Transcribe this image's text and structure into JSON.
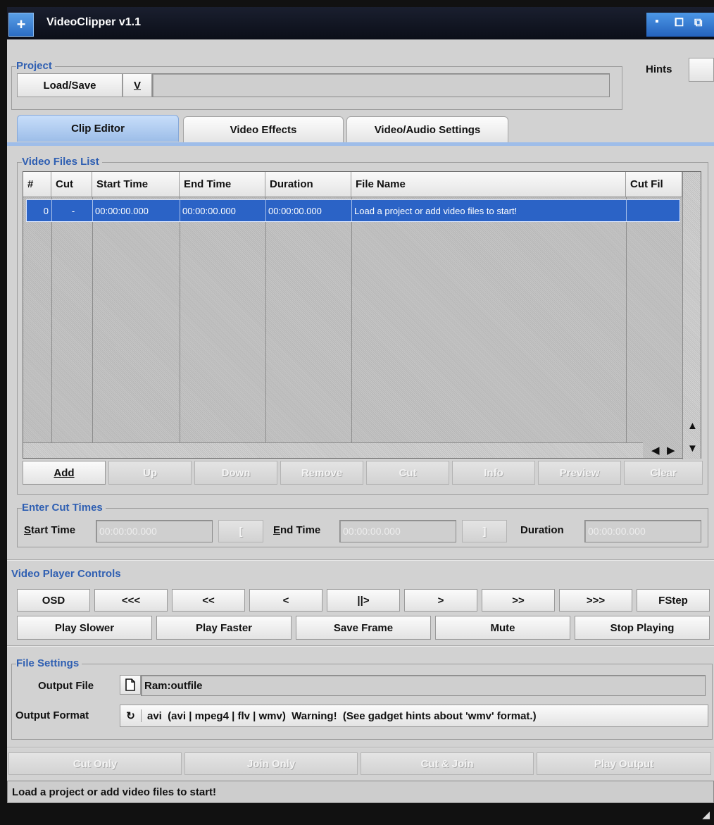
{
  "window": {
    "title": "VideoClipper v1.1"
  },
  "project": {
    "legend": "Project",
    "load_save_label": "Load/Save",
    "dropdown_label": "V",
    "project_field_value": "",
    "hints_label": "Hints"
  },
  "tabs": [
    {
      "label": "Clip Editor",
      "active": true
    },
    {
      "label": "Video Effects",
      "active": false
    },
    {
      "label": "Video/Audio Settings",
      "active": false
    }
  ],
  "video_files": {
    "legend": "Video Files List",
    "columns": [
      "#",
      "Cut",
      "Start Time",
      "End Time",
      "Duration",
      "File Name",
      "Cut Fil"
    ],
    "rows": [
      [
        "0",
        "-",
        "00:00:00.000",
        "00:00:00.000",
        "00:00:00.000",
        "Load a project or add video files to start!",
        ""
      ]
    ],
    "buttons": {
      "add": "Add",
      "up": "Up",
      "down": "Down",
      "remove": "Remove",
      "cut": "Cut",
      "info": "Info",
      "preview": "Preview",
      "clear": "Clear"
    }
  },
  "cut_times": {
    "legend": "Enter Cut Times",
    "start_label": "Start Time",
    "start_value": "00:00:00.000",
    "start_btn": "[",
    "end_label": "End Time",
    "end_value": "00:00:00.000",
    "end_btn": "]",
    "duration_label": "Duration",
    "duration_value": "00:00:00.000"
  },
  "player": {
    "legend": "Video Player Controls",
    "row1": [
      "OSD",
      "<<<",
      "<<",
      "<",
      "||>",
      ">",
      ">>",
      ">>>",
      "FStep"
    ],
    "row2": [
      "Play Slower",
      "Play Faster",
      "Save Frame",
      "Mute",
      "Stop Playing"
    ]
  },
  "file_settings": {
    "legend": "File Settings",
    "output_file_label": "Output File",
    "output_file_value": "Ram:outfile",
    "output_format_label": "Output Format",
    "output_format_value": "avi  (avi | mpeg4 | flv | wmv)  Warning!  (See gadget hints about 'wmv' format.)"
  },
  "actions": [
    "Cut Only",
    "Join Only",
    "Cut & Join",
    "Play Output"
  ],
  "status": "Load a project or add video files to start!",
  "colors": {
    "accent": "#2f5fb2",
    "selection": "#2b63c6",
    "tab_active": "#9cbde8"
  }
}
